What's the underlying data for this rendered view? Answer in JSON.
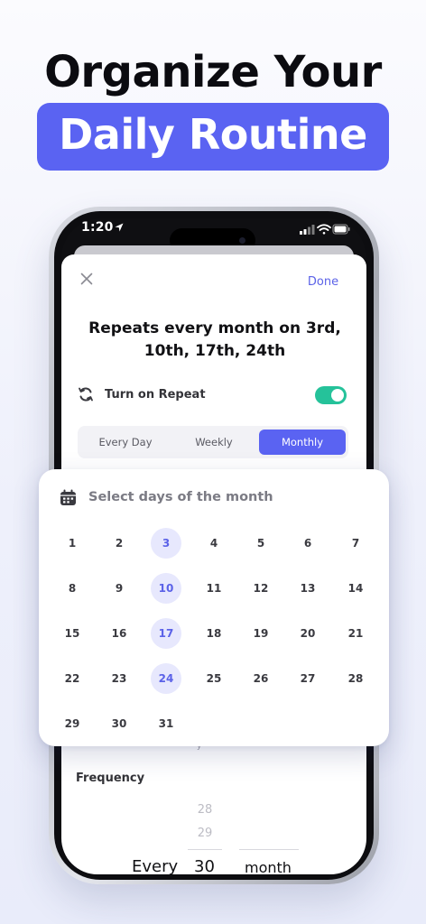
{
  "hero": {
    "line1": "Organize Your",
    "line2": "Daily Routine"
  },
  "status_bar": {
    "time": "1:20"
  },
  "sheet": {
    "done_label": "Done",
    "title": "Repeats every month on 3rd, 10th, 17th, 24th",
    "repeat_label": "Turn on Repeat",
    "repeat_on": true,
    "segments": [
      "Every Day",
      "Weekly",
      "Monthly"
    ],
    "active_segment": "Monthly",
    "frequency_label": "Frequency",
    "picker": {
      "faint_values": [
        "28",
        "29"
      ],
      "every_label": "Every",
      "selected_number": "30",
      "unit": "month"
    }
  },
  "days_card": {
    "title": "Select days of the month",
    "days": [
      "1",
      "2",
      "3",
      "4",
      "5",
      "6",
      "7",
      "8",
      "9",
      "10",
      "11",
      "12",
      "13",
      "14",
      "15",
      "16",
      "17",
      "18",
      "19",
      "20",
      "21",
      "22",
      "23",
      "24",
      "25",
      "26",
      "27",
      "28",
      "29",
      "30",
      "31"
    ],
    "selected_days": [
      "3",
      "10",
      "17",
      "24"
    ]
  },
  "colors": {
    "accent": "#5a63f2",
    "toggle_on": "#25c29a",
    "selected_day_bg": "#e7e8fd",
    "selected_day_text": "#5b62e8"
  }
}
